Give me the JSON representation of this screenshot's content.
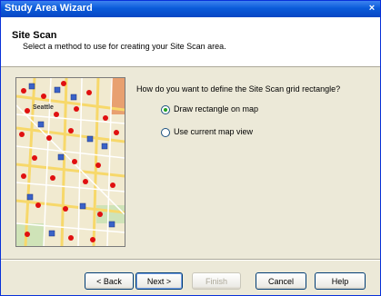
{
  "window": {
    "title": "Study Area Wizard",
    "close_glyph": "×"
  },
  "header": {
    "title": "Site Scan",
    "subtitle": "Select a method to use for creating your Site Scan area."
  },
  "map": {
    "label": "Seattle"
  },
  "prompt": {
    "question": "How do you want to define the Site Scan grid rectangle?",
    "options": [
      {
        "label": "Draw rectangle on map",
        "selected": true
      },
      {
        "label": "Use current map view",
        "selected": false
      }
    ]
  },
  "buttons": {
    "back": "< Back",
    "next": "Next >",
    "finish": "Finish",
    "cancel": "Cancel",
    "help": "Help"
  },
  "colors": {
    "title_bar": "#0a5bd9",
    "accent_green": "#21a121"
  }
}
